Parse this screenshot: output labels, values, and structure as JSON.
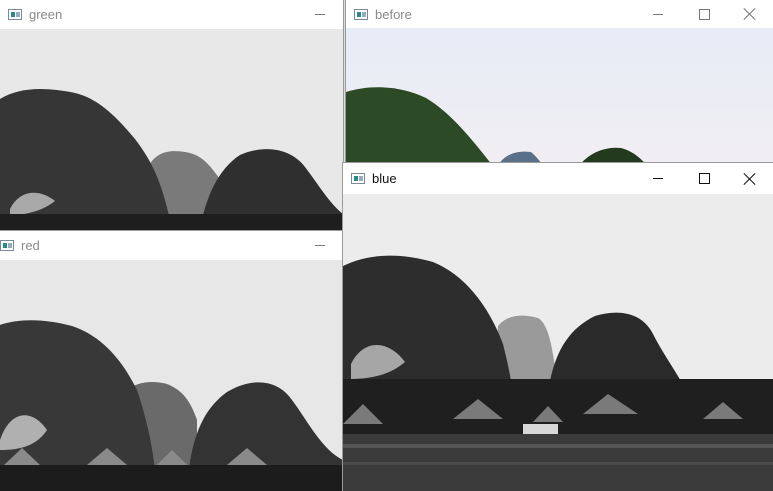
{
  "windows": {
    "green": {
      "title": "green"
    },
    "before": {
      "title": "before"
    },
    "red": {
      "title": "red"
    },
    "blue": {
      "title": "blue"
    }
  },
  "colors": {
    "sky_gray": "#e6e6e6",
    "sky_color": "#e4e8f4",
    "mountain_dark": "#2e2e2e",
    "mountain_green": "#2f4a24",
    "water": "#3a3a3a"
  },
  "icons": {
    "app": "opencv-window-icon",
    "minimize": "minimize-icon",
    "maximize": "maximize-icon",
    "close": "close-icon"
  }
}
